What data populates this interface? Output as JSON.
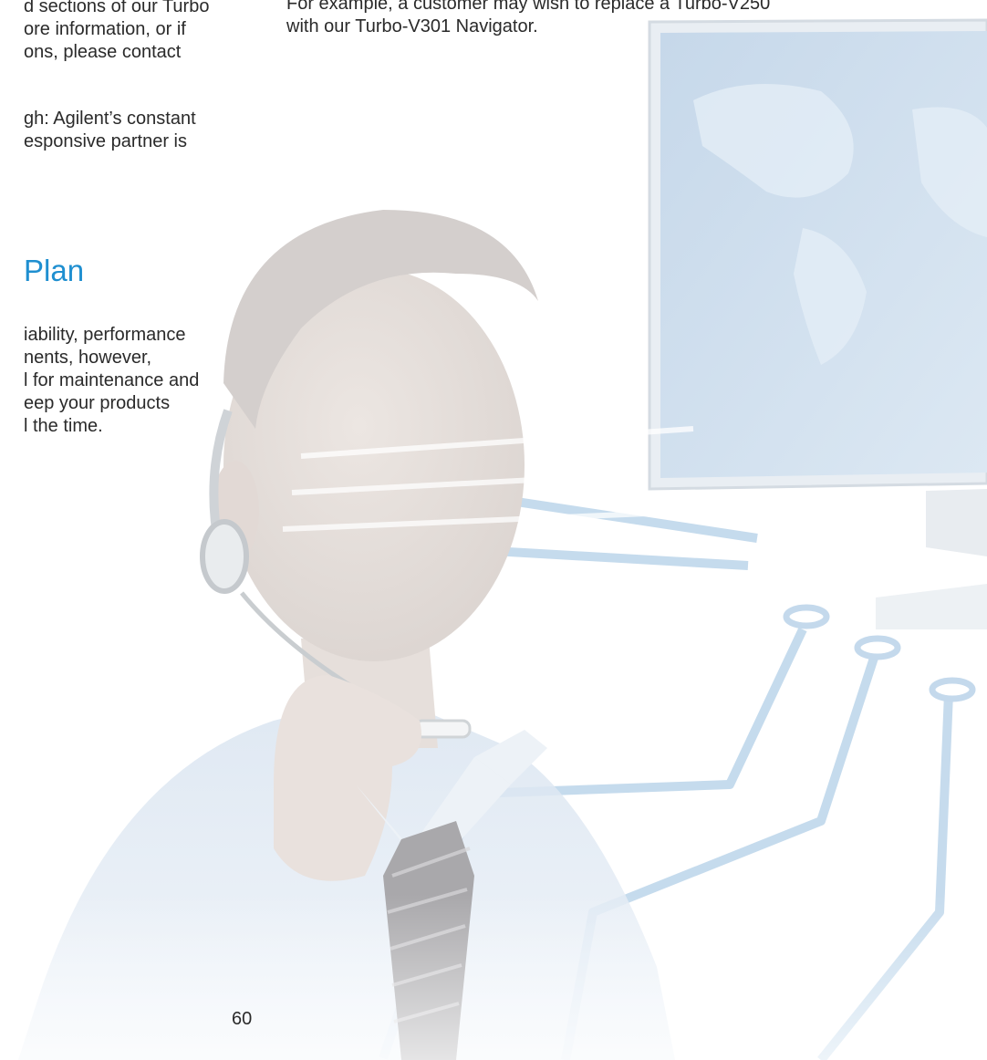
{
  "left_column": {
    "paragraph_1": [
      "d sections of our Turbo",
      "ore information, or if",
      "ons, please contact"
    ],
    "paragraph_2": [
      "gh: Agilent’s constant",
      "esponsive partner is"
    ],
    "heading": "Plan",
    "paragraph_3": [
      "iability, performance",
      "nents, however,",
      "l for maintenance and",
      "eep your products",
      "l the time."
    ]
  },
  "right_column": {
    "lines": [
      "For example, a customer may wish to replace a Turbo-V250",
      "with our Turbo-V301 Navigator."
    ]
  },
  "footer": {
    "page_number": "60"
  },
  "colors": {
    "heading_blue": "#1f8fd0",
    "circuit_blue": "#b8d4ea"
  }
}
